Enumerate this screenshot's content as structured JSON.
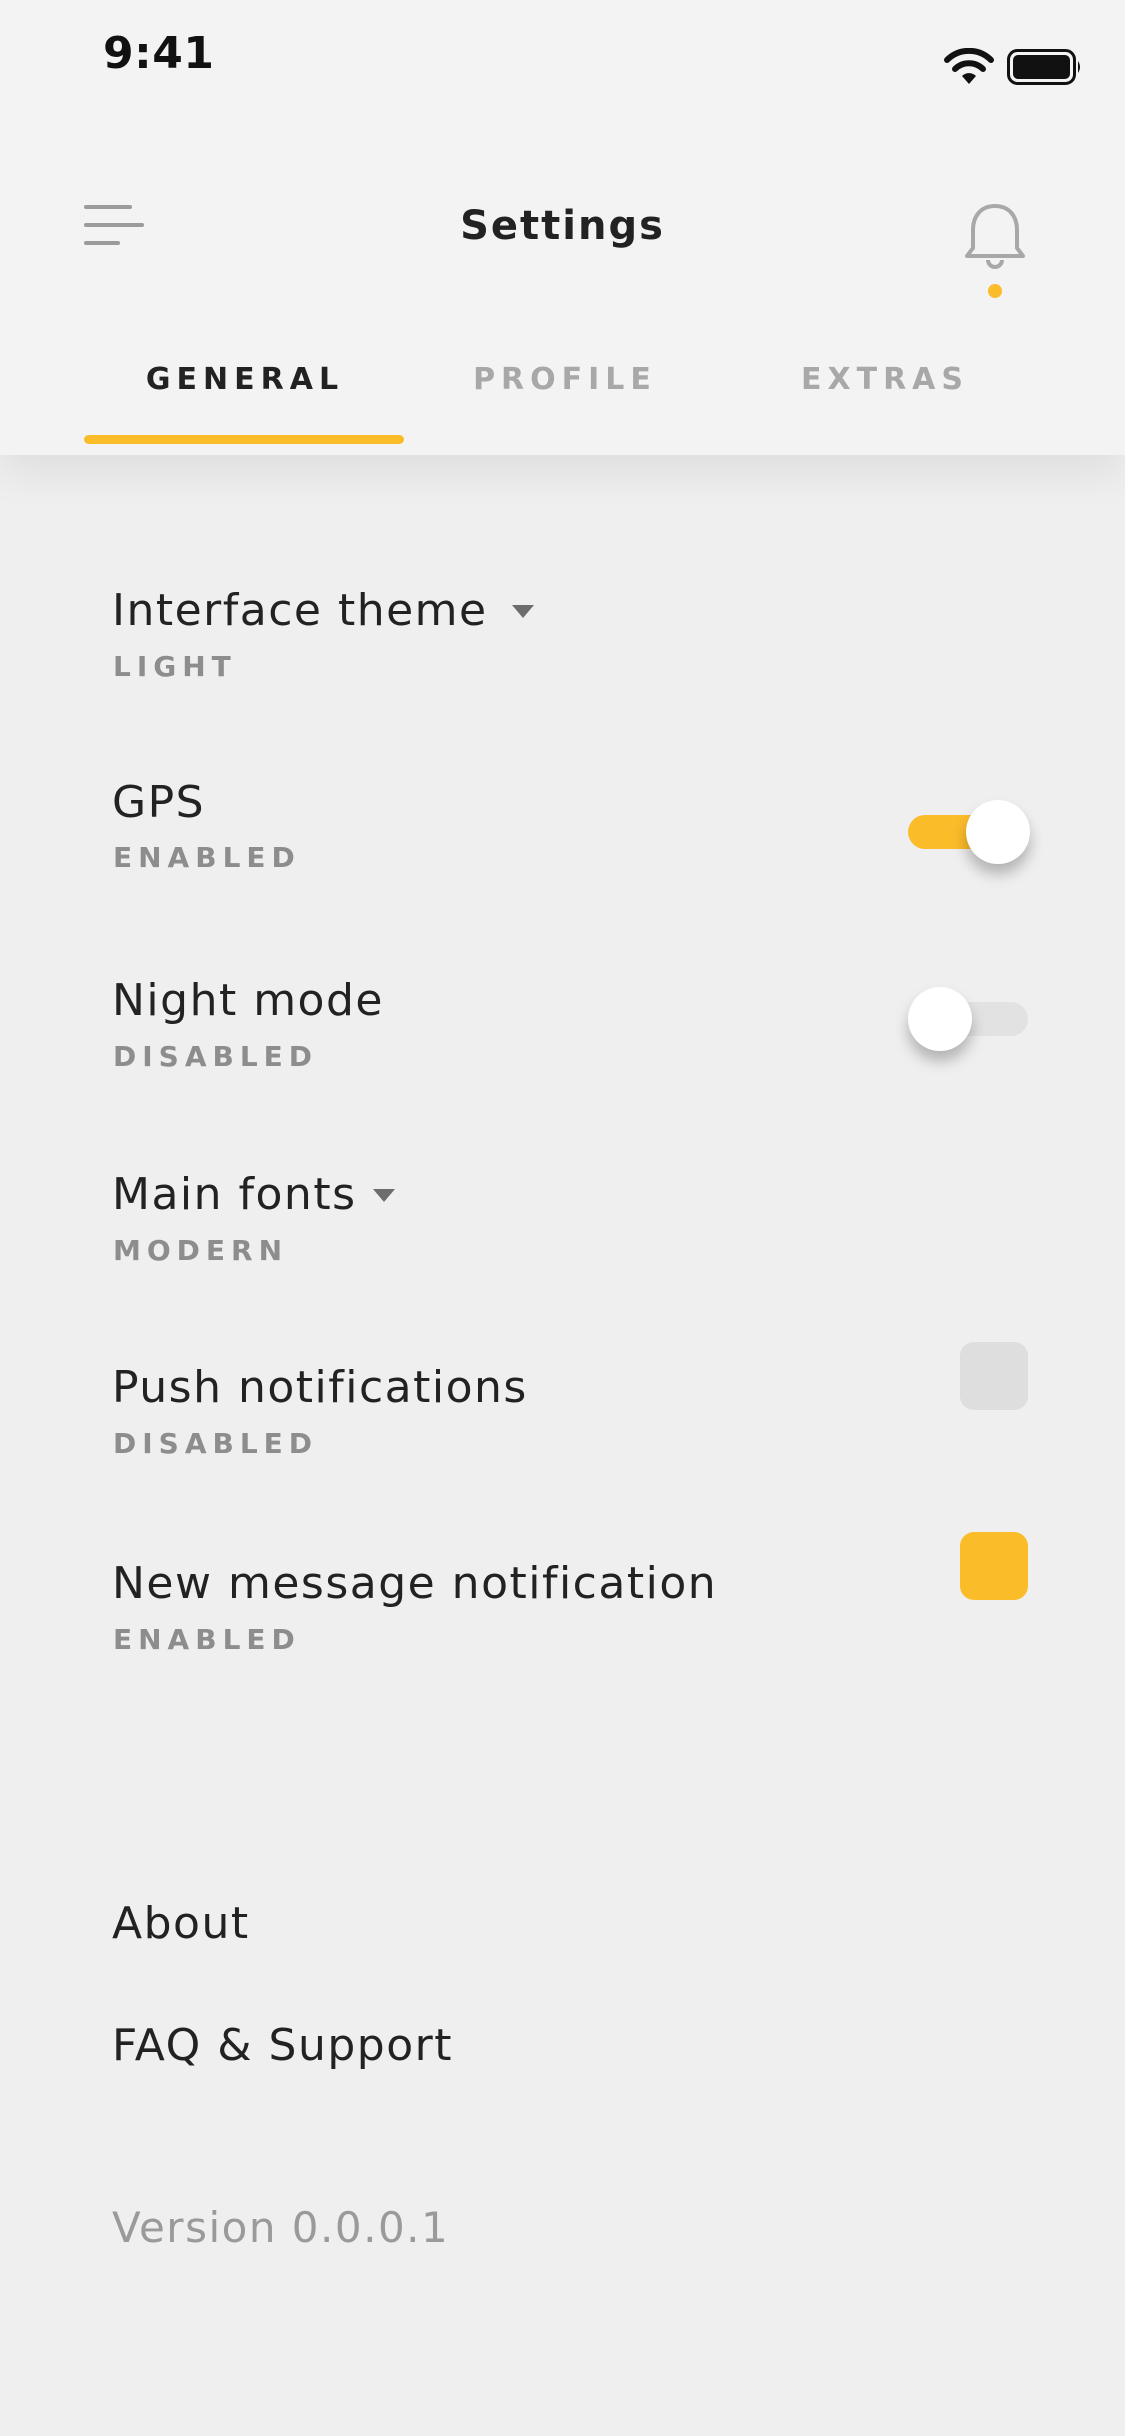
{
  "status_bar": {
    "time": "9:41"
  },
  "header": {
    "title": "Settings",
    "menu_icon": "hamburger-menu-icon",
    "notification_icon": "bell-icon",
    "notification_dot_color": "#fbbc2a"
  },
  "tabs": [
    {
      "label": "GENERAL",
      "active": true
    },
    {
      "label": "PROFILE",
      "active": false
    },
    {
      "label": "EXTRAS",
      "active": false
    }
  ],
  "accent_color": "#fbbc2a",
  "settings": {
    "interface_theme": {
      "label": "Interface theme",
      "value": "LIGHT",
      "control": "dropdown"
    },
    "gps": {
      "label": "GPS",
      "value": "ENABLED",
      "control": "toggle",
      "on": true
    },
    "night_mode": {
      "label": "Night mode",
      "value": "DISABLED",
      "control": "toggle",
      "on": false
    },
    "main_fonts": {
      "label": "Main fonts",
      "value": "MODERN",
      "control": "dropdown"
    },
    "push_notifications": {
      "label": "Push notifications",
      "value": "DISABLED",
      "control": "checkbox",
      "checked": false
    },
    "new_message_notification": {
      "label": "New message notification",
      "value": "ENABLED",
      "control": "checkbox",
      "checked": true
    }
  },
  "links": {
    "about": "About",
    "faq": "FAQ & Support"
  },
  "version": "Version 0.0.0.1"
}
